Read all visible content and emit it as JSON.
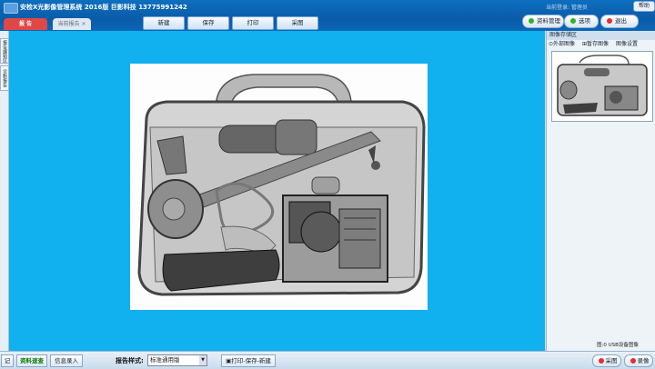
{
  "header": {
    "title": "安检X光影像管理系统 2016版   巨影科技   13775991242",
    "login_user": "当前登录: 管理员",
    "help": "帮助",
    "tabs": [
      {
        "label": "报 告"
      },
      {
        "label": "当前报告 ×"
      }
    ],
    "toolbar": [
      "新建",
      "保存",
      "打印",
      "采图"
    ],
    "right_buttons": [
      {
        "label": "资料管理",
        "color": "#2db42d"
      },
      {
        "label": "选项",
        "color": "#2db42d"
      },
      {
        "label": "退出",
        "color": "#e03030"
      }
    ]
  },
  "left_tabs": [
    "报告编辑区",
    "诊断报告"
  ],
  "right_panel": {
    "title": "图像存储区",
    "tools": [
      "外部图像",
      "暂存图像",
      "图像设置"
    ],
    "image_count": "图:0  USB设备图像"
  },
  "bottom": {
    "partial_left": "记",
    "quick_search": "资料速查",
    "info_entry": "信息录入",
    "format_label": "报告样式:",
    "format_value": "标准通用版",
    "print_save_new": "打印-保存-新建",
    "capture": "采图",
    "record": "录像"
  },
  "colors": {
    "canvas": "#11b0ee",
    "header": "#0a5ca8",
    "accent_red": "#e04848"
  }
}
